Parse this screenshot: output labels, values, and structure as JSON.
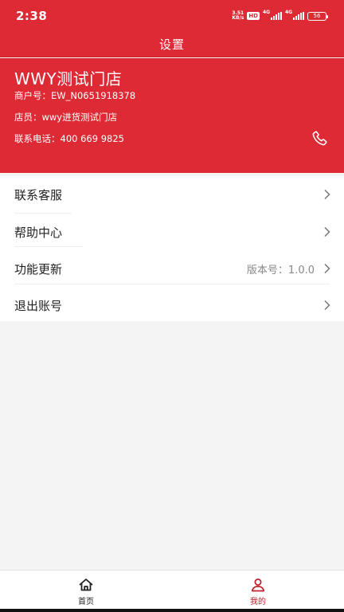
{
  "status_bar": {
    "time": "2:38",
    "net_speed_value": "3.51",
    "net_speed_unit": "KB/s",
    "hd_badge": "HD",
    "signal_1_label": "4G",
    "signal_2_label": "4G",
    "battery": "56"
  },
  "nav": {
    "title": "设置"
  },
  "profile": {
    "store_name": "WWY测试门店",
    "merchant_no": "商户号：EW_N0651918378",
    "clerk": "店员：wwy进货测试门店",
    "phone": "联系电话：400 669 9825",
    "phone_icon": "phone-icon"
  },
  "menu": {
    "items": [
      {
        "label": "联系客服",
        "value": ""
      },
      {
        "label": "帮助中心",
        "value": ""
      },
      {
        "label": "功能更新",
        "value": "版本号：1.0.0"
      },
      {
        "label": "退出账号",
        "value": ""
      }
    ]
  },
  "tabs": [
    {
      "label": "首页",
      "icon": "home-icon",
      "active": false
    },
    {
      "label": "我的",
      "icon": "user-icon",
      "active": true
    }
  ],
  "colors": {
    "brand_red": "#dd2a35",
    "active_tab": "#c0212c",
    "inactive_tab": "#222222",
    "background": "#f4f4f4"
  }
}
